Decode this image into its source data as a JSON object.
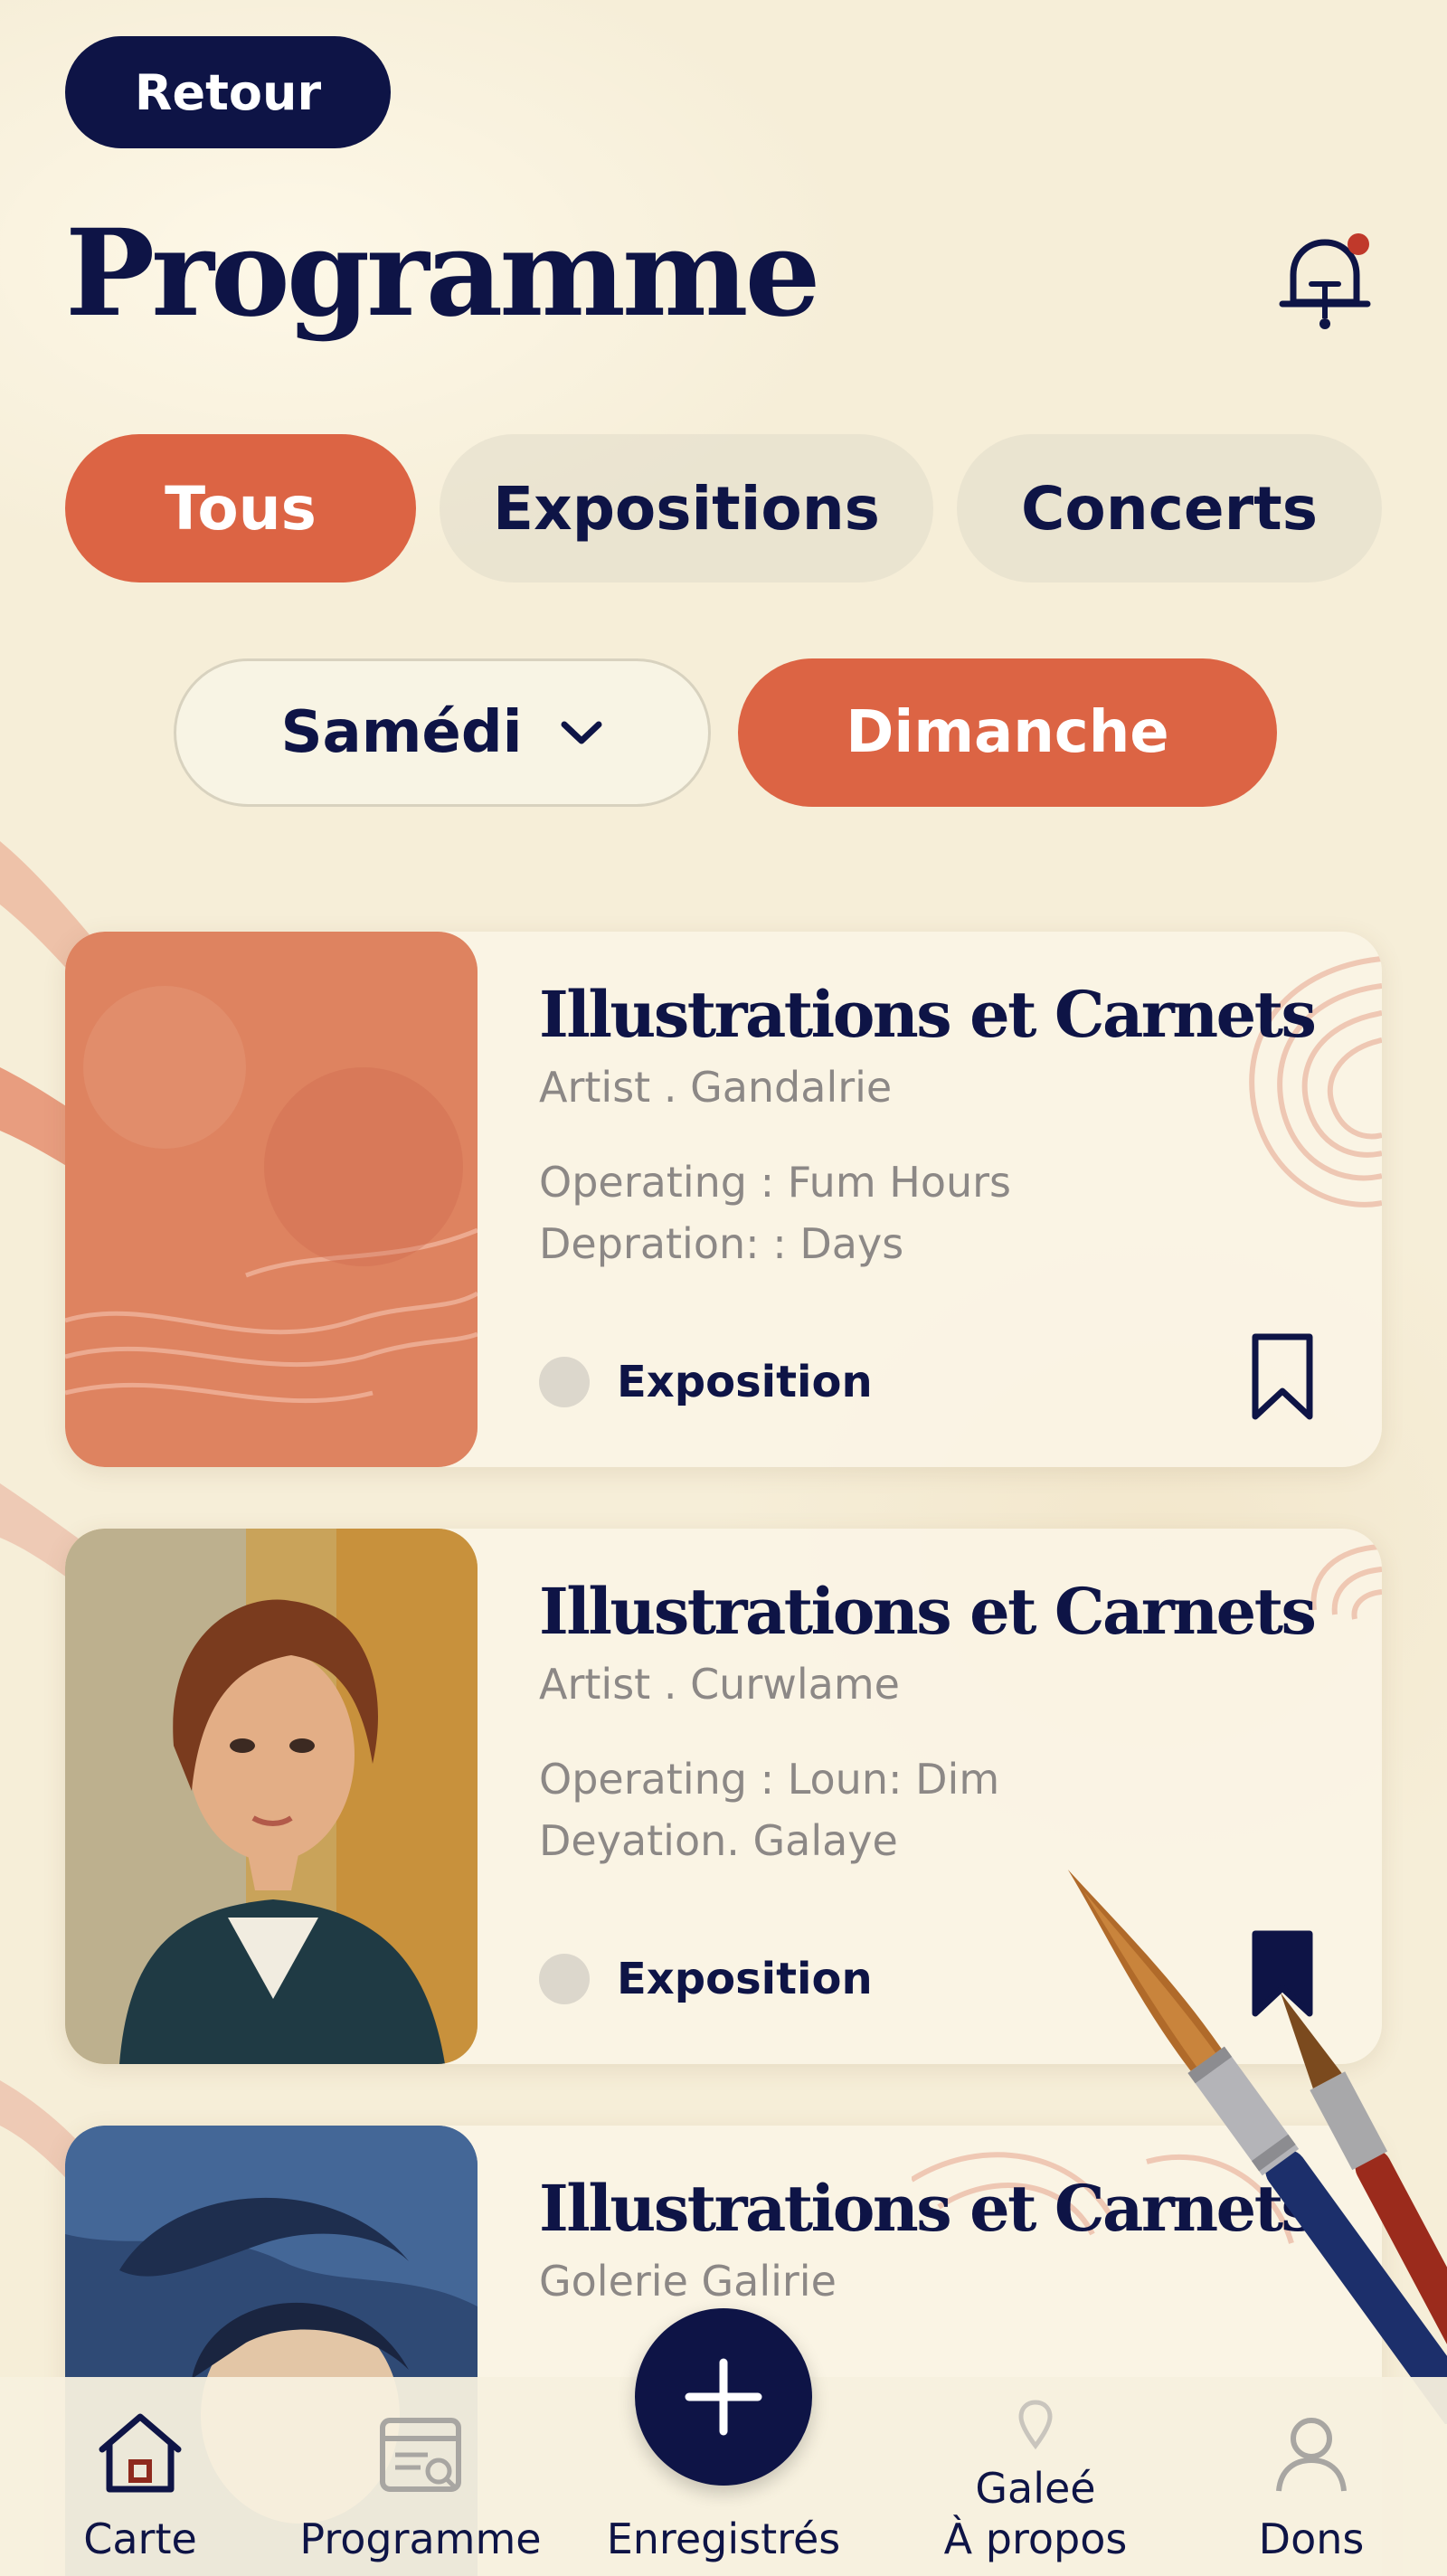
{
  "header": {
    "back_label": "Retour",
    "title": "Programme"
  },
  "tabs": [
    {
      "label": "Tous",
      "active": true
    },
    {
      "label": "Expositions",
      "active": false
    },
    {
      "label": "Concerts",
      "active": false
    }
  ],
  "days": [
    {
      "label": "Samédi",
      "active": false
    },
    {
      "label": "Dimanche",
      "active": true
    }
  ],
  "events": [
    {
      "title": "Illustrations et Carnets",
      "artist": "Artist . Gandalrie",
      "meta_line1": "Operating : Fum Hours",
      "meta_line2": "Depration: : Days",
      "tag": "Exposition",
      "saved": false,
      "thumb": "terracotta-abstract"
    },
    {
      "title": "Illustrations et Carnets",
      "artist": "Artist . Curwlame",
      "meta_line1": "Operating : Loun: Dim",
      "meta_line2": "Deyation. Galaye",
      "tag": "Exposition",
      "saved": true,
      "thumb": "portrait-painting"
    },
    {
      "title": "Illustrations et Carnets",
      "artist": "Golerie Galirie",
      "thumb": "blue-portrait"
    }
  ],
  "fab": {
    "icon": "plus-icon"
  },
  "bottom_nav": {
    "carte": "Carte",
    "programme": "Programme",
    "saved": "Enregistrés",
    "about_top": "Galeé",
    "about": "À propos",
    "dons": "Dons"
  },
  "colors": {
    "navy": "#0e1446",
    "accent": "#dc6444",
    "paper": "#f6eed8"
  }
}
